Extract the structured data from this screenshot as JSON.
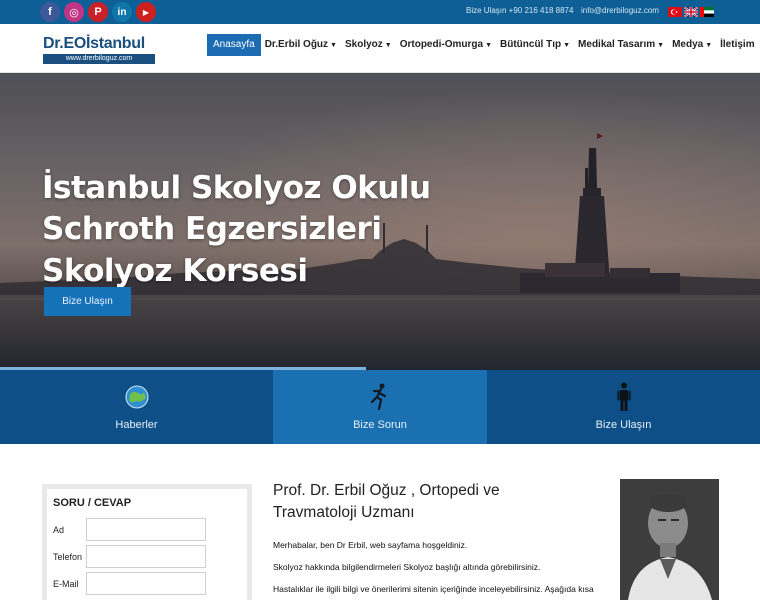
{
  "topbar": {
    "social": [
      {
        "icon": "facebook-icon",
        "glyph": "f",
        "color": "#3b5998"
      },
      {
        "icon": "instagram-icon",
        "glyph": "◎",
        "color": "#c13584"
      },
      {
        "icon": "pinterest-icon",
        "glyph": "P",
        "color": "#cb2027"
      },
      {
        "icon": "linkedin-icon",
        "glyph": "in",
        "color": "#0e76a8"
      },
      {
        "icon": "youtube-icon",
        "glyph": "▶",
        "color": "#cd201f"
      }
    ],
    "phone": "Bize Ulaşın +90 216 418 8874",
    "email": "info@drerbiloguz.com"
  },
  "logo": {
    "main": "Dr.EOİstanbul",
    "sub": "www.drerbiloguz.com"
  },
  "nav": {
    "home": "Anasayfa",
    "erbil": "Dr.Erbil Oğuz",
    "skolyoz": "Skolyoz",
    "ortopedi": "Ortopedi-Omurga",
    "butuncul": "Bütüncül Tıp",
    "medikal": "Medikal Tasarım",
    "medya": "Medya",
    "iletisim": "İletişim"
  },
  "hero": {
    "line1": "İstanbul Skolyoz Okulu",
    "line2": "Schroth Egzersizleri",
    "line3": "Skolyoz Korsesi",
    "button": "Bize Ulaşın"
  },
  "features": {
    "haberler": "Haberler",
    "sorun": "Bize Sorun",
    "ulasin": "Bize Ulaşın"
  },
  "form": {
    "title": "SORU / CEVAP",
    "ad": "Ad",
    "telefon": "Telefon",
    "email": "E-Mail"
  },
  "article": {
    "title": "Prof. Dr. Erbil Oğuz , Ortopedi ve Travmatoloji Uzmanı",
    "p1": "Merhabalar, ben Dr Erbil, web sayfama hoşgeldiniz.",
    "p2": "Skolyoz hakkında bilgilendirmeleri Skolyoz başlığı altında görebilirsiniz.",
    "p3": "Hastalıklar ile ilgili bilgi ve önerilerimi sitenin içeriğinde inceleyebilirsiniz.  Aşağıda kısa"
  },
  "colors": {
    "topbar": "#0d5f95",
    "accent": "#1b6cb3",
    "feature_dark": "#0d4f86",
    "feature_light": "#1a70b0"
  }
}
